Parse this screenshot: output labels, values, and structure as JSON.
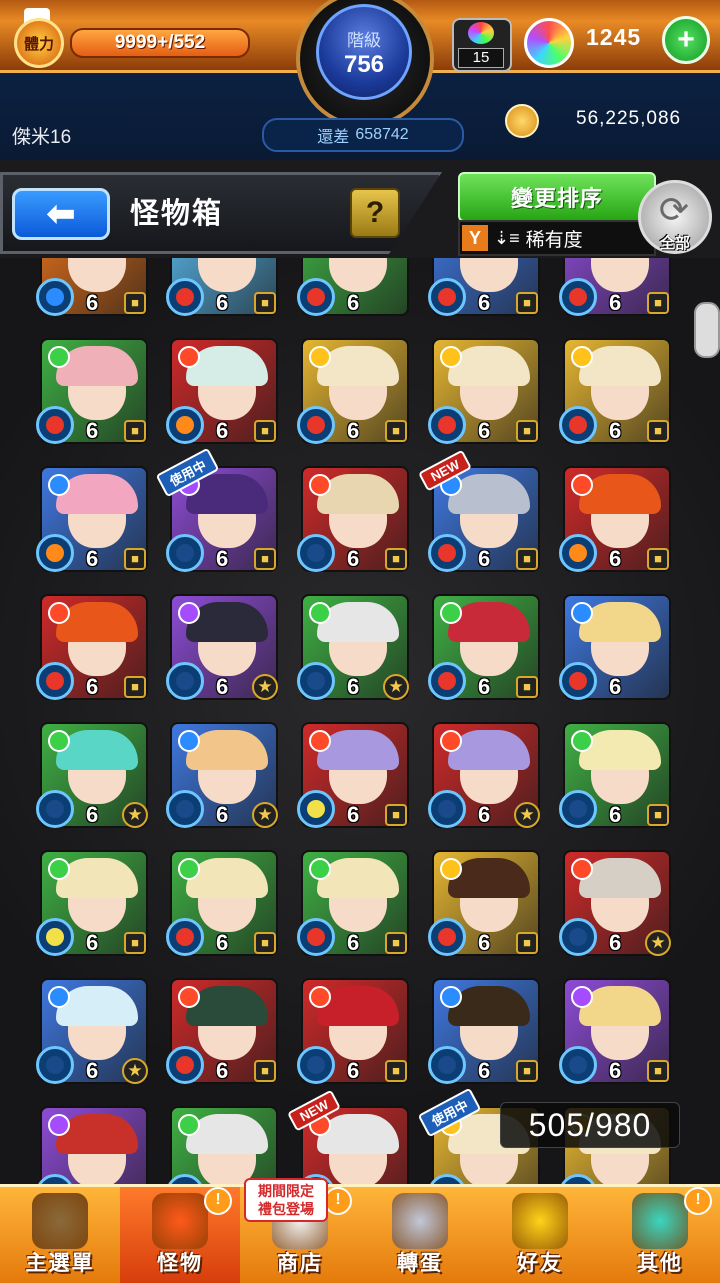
{
  "header": {
    "stamina_label": "體力",
    "stamina_current": "9999+",
    "stamina_max": "/552",
    "rank_label": "階級",
    "rank_value": "756",
    "exp_remaining_label": "還差",
    "exp_remaining_value": "658742",
    "player_name": "傑米16",
    "orb_box_count": "15",
    "gem_count": "1245",
    "coin_count": "56,225,086",
    "app_badge": "▲"
  },
  "toolbar": {
    "back_glyph": "⬅",
    "title": "怪物箱",
    "help_glyph": "?",
    "sort_button": "變更排序",
    "sort_current": "稀有度",
    "filter_glyph": "Y",
    "sort_glyph": "⇣≡",
    "all_label": "全部",
    "refresh_glyph": "⟳"
  },
  "monster_box": {
    "capacity_text": "505/980",
    "tags": {
      "in_use": "使用中",
      "new": "NEW"
    },
    "cells": [
      {
        "row": 0,
        "col": 0,
        "level": "6",
        "badge": "lock",
        "bg": "#e2711c",
        "hair": "#3a2a4a",
        "elem": "#ff5a2a",
        "bubble": "#2a8cff"
      },
      {
        "row": 0,
        "col": 1,
        "level": "6",
        "badge": "lock",
        "bg": "#58b5e8",
        "hair": "#8fe6c8",
        "elem": "#2a8cff",
        "bubble": "#e8362a"
      },
      {
        "row": 0,
        "col": 2,
        "level": "6",
        "badge": "none",
        "bg": "#3fb044",
        "hair": "#6a8a4a",
        "elem": "#3ccf48",
        "bubble": "#e8362a"
      },
      {
        "row": 0,
        "col": 3,
        "level": "6",
        "badge": "lock",
        "bg": "#3f78e0",
        "hair": "#9ab0f0",
        "elem": "#2a8cff",
        "bubble": "#e8362a"
      },
      {
        "row": 0,
        "col": 4,
        "level": "6",
        "badge": "lock",
        "bg": "#8e4cd6",
        "hair": "#5d6ab0",
        "elem": "#a54cff",
        "bubble": "#e8362a"
      },
      {
        "row": 1,
        "col": 0,
        "level": "6",
        "badge": "lock",
        "bg": "#3fb044",
        "hair": "#f0b0b8",
        "elem": "#3ccf48",
        "bubble": "#e8362a"
      },
      {
        "row": 1,
        "col": 1,
        "level": "6",
        "badge": "lock",
        "bg": "#d02a2a",
        "hair": "#d6ece6",
        "elem": "#ff4a2a",
        "bubble": "#ff8a1a"
      },
      {
        "row": 1,
        "col": 2,
        "level": "6",
        "badge": "lock",
        "bg": "#e6b632",
        "hair": "#f2e6c6",
        "elem": "#ffc21a",
        "bubble": "#e8362a"
      },
      {
        "row": 1,
        "col": 3,
        "level": "6",
        "badge": "lock",
        "bg": "#e6b632",
        "hair": "#f2e6c6",
        "elem": "#ffc21a",
        "bubble": "#e8362a"
      },
      {
        "row": 1,
        "col": 4,
        "level": "6",
        "badge": "lock",
        "bg": "#e6b632",
        "hair": "#f2e6c6",
        "elem": "#ffc21a",
        "bubble": "#e8362a"
      },
      {
        "row": 2,
        "col": 0,
        "level": "6",
        "badge": "lock",
        "bg": "#3f78e0",
        "hair": "#f2a6c0",
        "elem": "#2a8cff",
        "bubble": "#ff8a1a"
      },
      {
        "row": 2,
        "col": 1,
        "level": "6",
        "badge": "lock",
        "bg": "#8e4cd6",
        "hair": "#4a2a7a",
        "elem": "#a54cff",
        "bubble": "#1a4a8a",
        "tag": "in_use"
      },
      {
        "row": 2,
        "col": 2,
        "level": "6",
        "badge": "lock",
        "bg": "#d02a2a",
        "hair": "#e8d6b0",
        "elem": "#ff4a2a",
        "bubble": "#1a4a8a"
      },
      {
        "row": 2,
        "col": 3,
        "level": "6",
        "badge": "lock",
        "bg": "#3f78e0",
        "hair": "#b8c0d0",
        "elem": "#2a8cff",
        "bubble": "#e8362a",
        "tag": "new"
      },
      {
        "row": 2,
        "col": 4,
        "level": "6",
        "badge": "lock",
        "bg": "#d02a2a",
        "hair": "#e8561a",
        "elem": "#ff4a2a",
        "bubble": "#ff8a1a"
      },
      {
        "row": 3,
        "col": 0,
        "level": "6",
        "badge": "lock",
        "bg": "#d02a2a",
        "hair": "#e8561a",
        "elem": "#ff4a2a",
        "bubble": "#e8362a"
      },
      {
        "row": 3,
        "col": 1,
        "level": "6",
        "badge": "star",
        "bg": "#8e4cd6",
        "hair": "#2a2a3a",
        "elem": "#a54cff",
        "bubble": "#1a4a8a"
      },
      {
        "row": 3,
        "col": 2,
        "level": "6",
        "badge": "star",
        "bg": "#3fb044",
        "hair": "#e6e6e6",
        "elem": "#3ccf48",
        "bubble": "#1a4a8a"
      },
      {
        "row": 3,
        "col": 3,
        "level": "6",
        "badge": "lock",
        "bg": "#3fb044",
        "hair": "#c82a3a",
        "elem": "#3ccf48",
        "bubble": "#e8362a"
      },
      {
        "row": 3,
        "col": 4,
        "level": "6",
        "badge": "none",
        "bg": "#3f78e0",
        "hair": "#f2d68a",
        "elem": "#2a8cff",
        "bubble": "#e8362a"
      },
      {
        "row": 4,
        "col": 0,
        "level": "6",
        "badge": "star",
        "bg": "#3fb044",
        "hair": "#5ad6c6",
        "elem": "#3ccf48",
        "bubble": "#1a4a8a"
      },
      {
        "row": 4,
        "col": 1,
        "level": "6",
        "badge": "star",
        "bg": "#3f78e0",
        "hair": "#f2c68a",
        "elem": "#2a8cff",
        "bubble": "#1a4a8a"
      },
      {
        "row": 4,
        "col": 2,
        "level": "6",
        "badge": "lock",
        "bg": "#d02a2a",
        "hair": "#a898e0",
        "elem": "#ff4a2a",
        "bubble": "#f2e04a"
      },
      {
        "row": 4,
        "col": 3,
        "level": "6",
        "badge": "star",
        "bg": "#d02a2a",
        "hair": "#a898e0",
        "elem": "#ff4a2a",
        "bubble": "#1a4a8a"
      },
      {
        "row": 4,
        "col": 4,
        "level": "6",
        "badge": "lock",
        "bg": "#3fb044",
        "hair": "#f2eab0",
        "elem": "#3ccf48",
        "bubble": "#1a4a8a"
      },
      {
        "row": 5,
        "col": 0,
        "level": "6",
        "badge": "lock",
        "bg": "#3fb044",
        "hair": "#f2e6b8",
        "elem": "#3ccf48",
        "bubble": "#f2e04a"
      },
      {
        "row": 5,
        "col": 1,
        "level": "6",
        "badge": "lock",
        "bg": "#3fb044",
        "hair": "#f2e6b8",
        "elem": "#3ccf48",
        "bubble": "#e8362a"
      },
      {
        "row": 5,
        "col": 2,
        "level": "6",
        "badge": "lock",
        "bg": "#3fb044",
        "hair": "#f2e6b8",
        "elem": "#3ccf48",
        "bubble": "#e8362a"
      },
      {
        "row": 5,
        "col": 3,
        "level": "6",
        "badge": "lock",
        "bg": "#e6b632",
        "hair": "#4a2a1a",
        "elem": "#ffc21a",
        "bubble": "#e8362a"
      },
      {
        "row": 5,
        "col": 4,
        "level": "6",
        "badge": "star",
        "bg": "#d02a2a",
        "hair": "#d6cfc6",
        "elem": "#ff4a2a",
        "bubble": "#1a4a8a"
      },
      {
        "row": 6,
        "col": 0,
        "level": "6",
        "badge": "star",
        "bg": "#3f78e0",
        "hair": "#d6eef8",
        "elem": "#2a8cff",
        "bubble": "#1a4a8a"
      },
      {
        "row": 6,
        "col": 1,
        "level": "6",
        "badge": "lock",
        "bg": "#d02a2a",
        "hair": "#2a4a3a",
        "elem": "#ff4a2a",
        "bubble": "#e8362a"
      },
      {
        "row": 6,
        "col": 2,
        "level": "6",
        "badge": "lock",
        "bg": "#d02a2a",
        "hair": "#c8202a",
        "elem": "#ff4a2a",
        "bubble": "#1a4a8a"
      },
      {
        "row": 6,
        "col": 3,
        "level": "6",
        "badge": "lock",
        "bg": "#3f78e0",
        "hair": "#3a2a1a",
        "elem": "#2a8cff",
        "bubble": "#1a4a8a"
      },
      {
        "row": 6,
        "col": 4,
        "level": "6",
        "badge": "lock",
        "bg": "#8e4cd6",
        "hair": "#f2d68a",
        "elem": "#a54cff",
        "bubble": "#1a4a8a"
      },
      {
        "row": 7,
        "col": 0,
        "level": "",
        "badge": "none",
        "bg": "#8e4cd6",
        "hair": "#c8302a",
        "elem": "#a54cff",
        "bubble": "#1a4a8a"
      },
      {
        "row": 7,
        "col": 1,
        "level": "",
        "badge": "none",
        "bg": "#3fb044",
        "hair": "#e6e6e6",
        "elem": "#3ccf48",
        "bubble": "#1a4a8a"
      },
      {
        "row": 7,
        "col": 2,
        "level": "",
        "badge": "none",
        "bg": "#d02a2a",
        "hair": "#e6e6e6",
        "elem": "#ff4a2a",
        "bubble": "#1a4a8a",
        "tag": "new"
      },
      {
        "row": 7,
        "col": 3,
        "level": "",
        "badge": "none",
        "bg": "#e6b632",
        "hair": "#f2e6c6",
        "elem": "#ffc21a",
        "bubble": "#1a4a8a",
        "tag": "in_use"
      },
      {
        "row": 7,
        "col": 4,
        "level": "",
        "badge": "none",
        "bg": "#e6b632",
        "hair": "#f2e6c6",
        "elem": "#ffc21a",
        "bubble": "#1a4a8a"
      }
    ]
  },
  "bottom_nav": {
    "promo_line1": "期間限定",
    "promo_line2": "禮包登場",
    "items": [
      {
        "label": "主選單",
        "icon_color": "#8a6a3a",
        "alert": ""
      },
      {
        "label": "怪物",
        "icon_color": "#ff5a1a",
        "alert": "!"
      },
      {
        "label": "商店",
        "icon_color": "#f2f2f2",
        "alert": "!"
      },
      {
        "label": "轉蛋",
        "icon_color": "#c0c8d8",
        "alert": ""
      },
      {
        "label": "好友",
        "icon_color": "#ffd21a",
        "alert": ""
      },
      {
        "label": "其他",
        "icon_color": "#3ad6c0",
        "alert": "!"
      }
    ]
  }
}
